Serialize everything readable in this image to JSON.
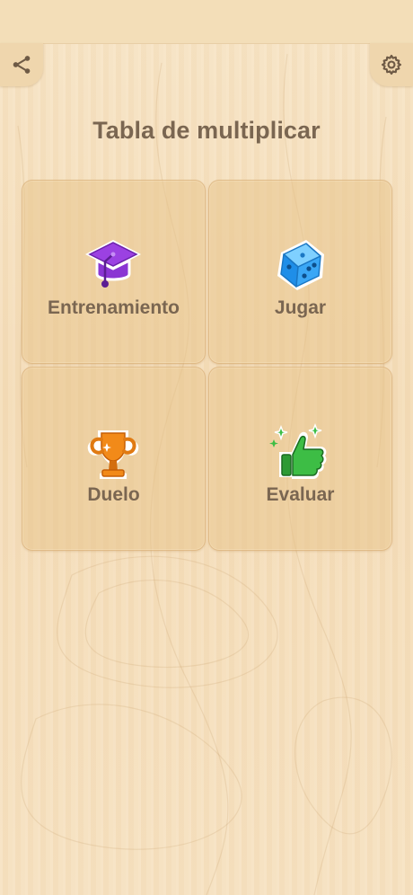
{
  "header": {
    "title": "Tabla de multiplicar",
    "share_icon": "share-icon",
    "settings_icon": "gear-icon"
  },
  "menu": {
    "items": [
      {
        "label": "Entrenamiento",
        "icon": "graduation-cap-icon",
        "color": "#9a3fe0"
      },
      {
        "label": "Jugar",
        "icon": "dice-icon",
        "color": "#2a9df4"
      },
      {
        "label": "Duelo",
        "icon": "trophy-icon",
        "color": "#f08c1c"
      },
      {
        "label": "Evaluar",
        "icon": "thumbs-up-icon",
        "color": "#35b33f"
      }
    ]
  },
  "colors": {
    "text": "#7a6651",
    "background": "#f6e3c4",
    "card": "#e8c48c"
  }
}
